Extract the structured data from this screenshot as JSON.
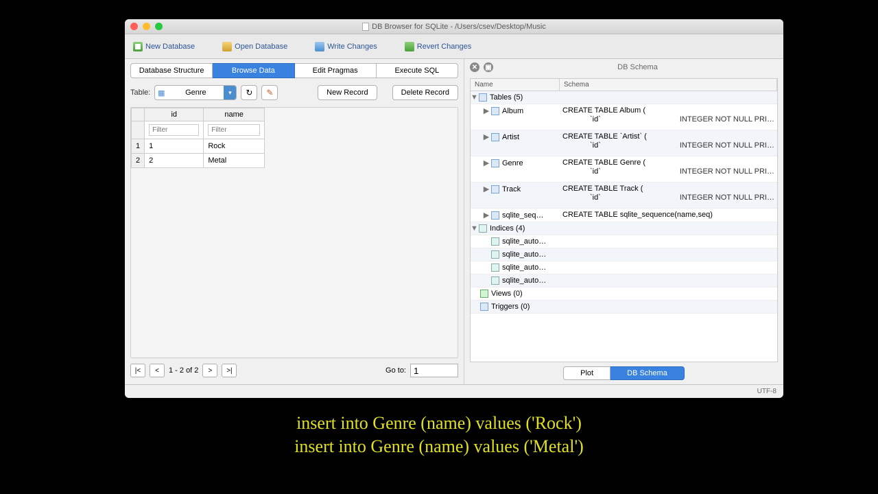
{
  "window": {
    "title": "DB Browser for SQLite - /Users/csev/Desktop/Music"
  },
  "toolbar": {
    "new_db": "New Database",
    "open_db": "Open Database",
    "write": "Write Changes",
    "revert": "Revert Changes"
  },
  "tabs": {
    "structure": "Database Structure",
    "browse": "Browse Data",
    "pragmas": "Edit Pragmas",
    "execute": "Execute SQL"
  },
  "browse": {
    "table_label": "Table:",
    "table_selected": "Genre",
    "new_record": "New Record",
    "delete_record": "Delete Record",
    "columns": {
      "id": "id",
      "name": "name"
    },
    "filter_ph": "Filter",
    "rows": [
      {
        "n": "1",
        "id": "1",
        "name": "Rock"
      },
      {
        "n": "2",
        "id": "2",
        "name": "Metal"
      }
    ],
    "pager": {
      "first": "|<",
      "prev": "<",
      "range": "1 - 2 of 2",
      "next": ">",
      "last": ">|",
      "goto_label": "Go to:",
      "goto_value": "1"
    }
  },
  "schema": {
    "panel_title": "DB Schema",
    "headers": {
      "name": "Name",
      "schema": "Schema"
    },
    "tables_label": "Tables (5)",
    "tables": [
      {
        "name": "Album",
        "line1": "CREATE TABLE Album (",
        "idlabel": "`id`",
        "type": "INTEGER NOT NULL PRI…"
      },
      {
        "name": "Artist",
        "line1": "CREATE TABLE `Artist` (",
        "idlabel": "`id`",
        "type": "INTEGER NOT NULL PRI…"
      },
      {
        "name": "Genre",
        "line1": "CREATE TABLE Genre (",
        "idlabel": "`id`",
        "type": "INTEGER NOT NULL PRI…"
      },
      {
        "name": "Track",
        "line1": "CREATE TABLE Track (",
        "idlabel": "`id`",
        "type": "INTEGER NOT NULL PRI…"
      }
    ],
    "sqlite_seq": {
      "name": "sqlite_seq…",
      "schema": "CREATE TABLE sqlite_sequence(name,seq)"
    },
    "indices_label": "Indices (4)",
    "index_item": "sqlite_auto…",
    "views": "Views (0)",
    "triggers": "Triggers (0)",
    "bottom_tabs": {
      "plot": "Plot",
      "schema": "DB Schema"
    }
  },
  "status": {
    "encoding": "UTF-8"
  },
  "caption": {
    "line1": "insert into Genre (name) values ('Rock')",
    "line2": "insert into Genre (name) values ('Metal')"
  }
}
